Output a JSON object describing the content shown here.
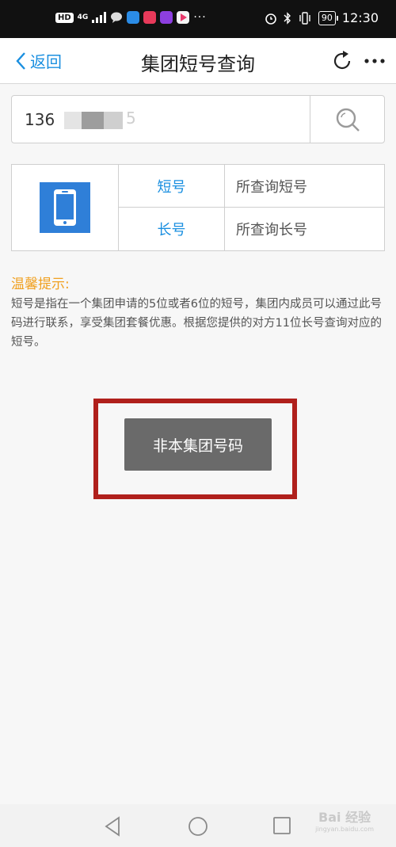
{
  "status_bar": {
    "hd": "HD",
    "network": "4G",
    "battery": "90",
    "time": "12:30",
    "more": "···"
  },
  "header": {
    "back_label": "返回",
    "title": "集团短号查询"
  },
  "search": {
    "value": "136",
    "value_suffix": "5",
    "icon": "search-icon"
  },
  "result": {
    "rows": [
      {
        "label": "短号",
        "value": "所查询短号"
      },
      {
        "label": "长号",
        "value": "所查询长号"
      }
    ]
  },
  "tips": {
    "title": "温馨提示:",
    "body": "短号是指在一个集团申请的5位或者6位的短号，集团内成员可以通过此号码进行联系，享受集团套餐优惠。根据您提供的对方11位长号查询对应的短号。"
  },
  "action": {
    "button_label": "非本集团号码"
  },
  "watermark": {
    "main": "Bai 经验",
    "sub": "jingyan.baidu.com"
  },
  "colors": {
    "accent": "#1a8fe0",
    "tips_title": "#f0a020",
    "highlight": "#b0201c",
    "button": "#6a6a6a"
  }
}
